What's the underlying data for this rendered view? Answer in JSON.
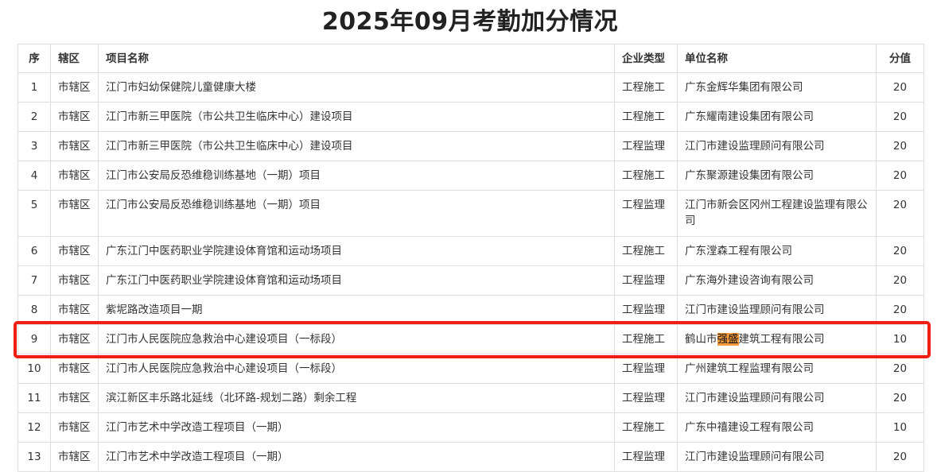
{
  "title": "2025年09月考勤加分情况",
  "columns": [
    "序",
    "辖区",
    "项目名称",
    "企业类型",
    "单位名称",
    "分值"
  ],
  "rows": [
    {
      "seq": "1",
      "district": "市辖区",
      "project": "江门市妇幼保健院儿童健康大楼",
      "type": "工程施工",
      "company": "广东金辉华集团有限公司",
      "score": "20"
    },
    {
      "seq": "2",
      "district": "市辖区",
      "project": "江门市新三甲医院（市公共卫生临床中心）建设项目",
      "type": "工程施工",
      "company": "广东耀南建设集团有限公司",
      "score": "20"
    },
    {
      "seq": "3",
      "district": "市辖区",
      "project": "江门市新三甲医院（市公共卫生临床中心）建设项目",
      "type": "工程监理",
      "company": "江门市建设监理顾问有限公司",
      "score": "20"
    },
    {
      "seq": "4",
      "district": "市辖区",
      "project": "江门市公安局反恐维稳训练基地（一期）项目",
      "type": "工程施工",
      "company": "广东聚源建设集团有限公司",
      "score": "20"
    },
    {
      "seq": "5",
      "district": "市辖区",
      "project": "江门市公安局反恐维稳训练基地（一期）项目",
      "type": "工程监理",
      "company": "江门市新会区冈州工程建设监理有限公司",
      "score": "20"
    },
    {
      "seq": "6",
      "district": "市辖区",
      "project": "广东江门中医药职业学院建设体育馆和运动场项目",
      "type": "工程施工",
      "company": "广东漟森工程有限公司",
      "score": "20"
    },
    {
      "seq": "7",
      "district": "市辖区",
      "project": "广东江门中医药职业学院建设体育馆和运动场项目",
      "type": "工程监理",
      "company": "广东海外建设咨询有限公司",
      "score": "20"
    },
    {
      "seq": "8",
      "district": "市辖区",
      "project": "紫坭路改造项目一期",
      "type": "工程监理",
      "company": "江门市建设监理顾问有限公司",
      "score": "20"
    },
    {
      "seq": "9",
      "district": "市辖区",
      "project": "江门市人民医院应急救治中心建设项目（一标段）",
      "type": "工程施工",
      "company_pre": "鹤山市",
      "company_hl": "强盛",
      "company_post": "建筑工程有限公司",
      "score": "10"
    },
    {
      "seq": "10",
      "district": "市辖区",
      "project": "江门市人民医院应急救治中心建设项目（一标段）",
      "type": "工程监理",
      "company": "广州建筑工程监理有限公司",
      "score": "20"
    },
    {
      "seq": "11",
      "district": "市辖区",
      "project": "滨江新区丰乐路北延线（北环路-规划二路）剩余工程",
      "type": "工程监理",
      "company": "江门市建设监理顾问有限公司",
      "score": "20"
    },
    {
      "seq": "12",
      "district": "市辖区",
      "project": "江门市艺术中学改造工程项目（一期）",
      "type": "工程施工",
      "company": "广东中禧建设工程有限公司",
      "score": "10"
    },
    {
      "seq": "13",
      "district": "市辖区",
      "project": "江门市艺术中学改造工程项目（一期）",
      "type": "工程监理",
      "company": "江门市建设监理顾问有限公司",
      "score": "20"
    }
  ],
  "colors": {
    "highlight_box": "#f01e14",
    "text_highlight": "#f39a3c",
    "border": "#dddddd"
  }
}
